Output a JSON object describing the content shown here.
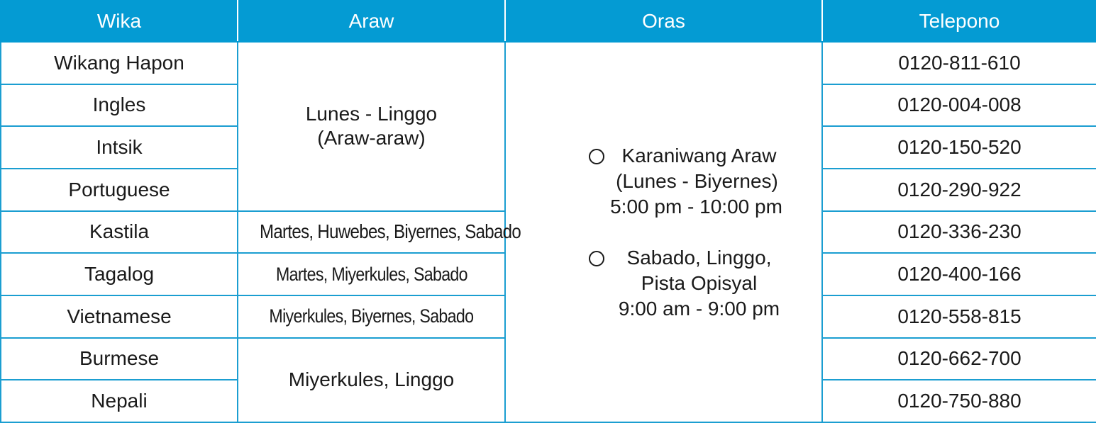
{
  "headers": {
    "language": "Wika",
    "days": "Araw",
    "hours": "Oras",
    "phone": "Telepono"
  },
  "rows": [
    {
      "language": "Wikang Hapon",
      "phone": "0120-811-610"
    },
    {
      "language": "Ingles",
      "phone": "0120-004-008"
    },
    {
      "language": "Intsik",
      "phone": "0120-150-520"
    },
    {
      "language": "Portuguese",
      "phone": "0120-290-922"
    },
    {
      "language": "Kastila",
      "phone": "0120-336-230"
    },
    {
      "language": "Tagalog",
      "phone": "0120-400-166"
    },
    {
      "language": "Vietnamese",
      "phone": "0120-558-815"
    },
    {
      "language": "Burmese",
      "phone": "0120-662-700"
    },
    {
      "language": "Nepali",
      "phone": "0120-750-880"
    }
  ],
  "days": {
    "group1_line1": "Lunes - Linggo",
    "group1_line2": "(Araw-araw)",
    "spanish": "Martes, Huwebes, Biyernes, Sabado",
    "tagalog": "Martes, Miyerkules, Sabado",
    "vietnamese": "Miyerkules, Biyernes, Sabado",
    "group2": "Miyerkules, Linggo"
  },
  "hours": {
    "weekday_title": "Karaniwang Araw",
    "weekday_days": "(Lunes - Biyernes)",
    "weekday_time": "5:00 pm - 10:00 pm",
    "weekend_title": "Sabado, Linggo,",
    "weekend_days": "Pista Opisyal",
    "weekend_time": "9:00 am - 9:00 pm"
  },
  "colors": {
    "header_bg": "#049bd3",
    "border": "#1b9ed1",
    "header_text": "#ffffff",
    "body_text": "#1a1a1a"
  },
  "icons": {
    "bullet": "circle-outline-icon"
  }
}
